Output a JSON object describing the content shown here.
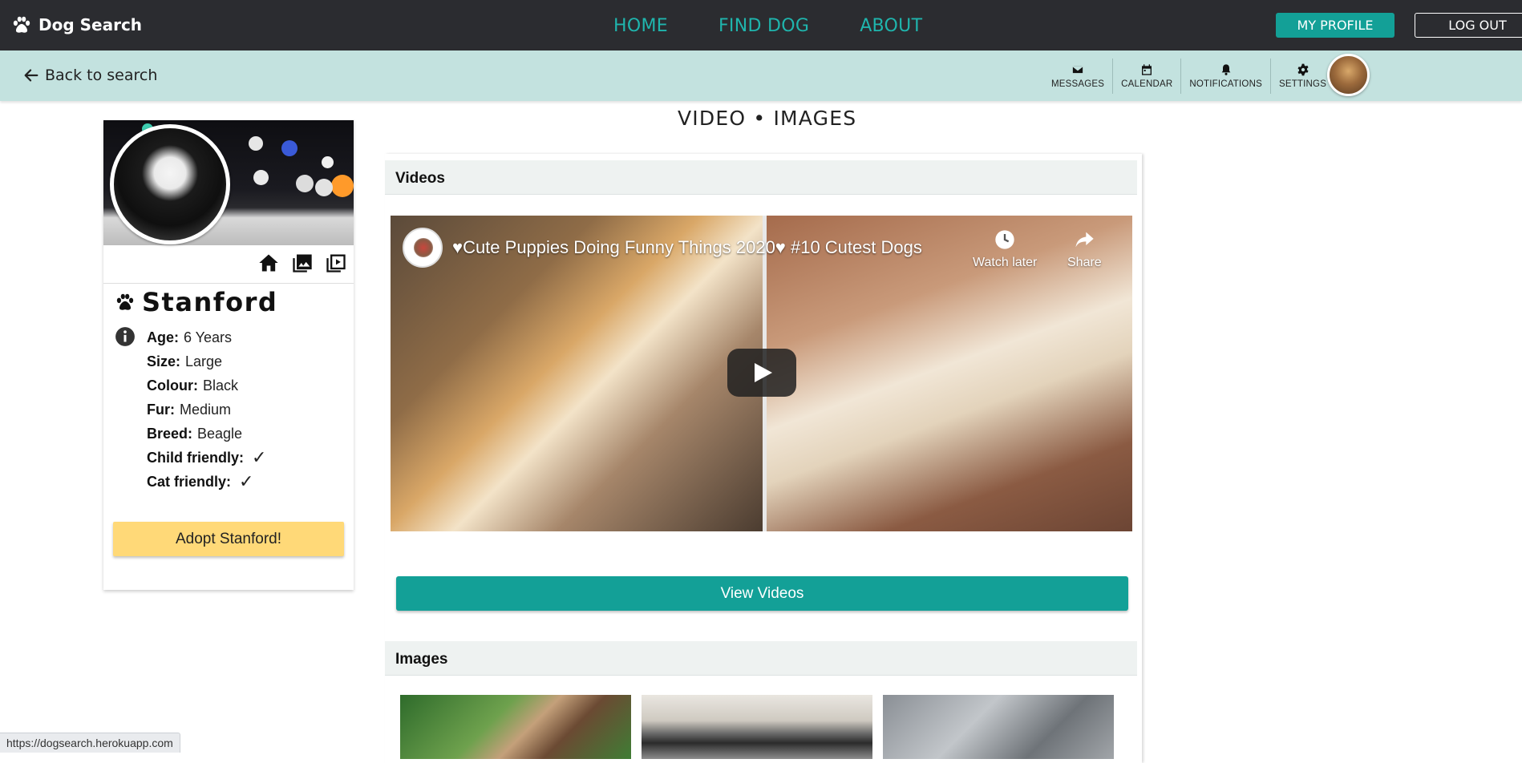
{
  "header": {
    "brand": "Dog Search",
    "nav": [
      "HOME",
      "FIND DOG",
      "ABOUT"
    ],
    "my_profile": "MY PROFILE",
    "logout": "LOG OUT"
  },
  "subbar": {
    "back": "Back to search",
    "tools": [
      {
        "label": "MESSAGES",
        "icon": "envelope-icon"
      },
      {
        "label": "CALENDAR",
        "icon": "calendar-icon"
      },
      {
        "label": "NOTIFICATIONS",
        "icon": "bell-icon"
      },
      {
        "label": "SETTINGS",
        "icon": "gear-icon"
      }
    ]
  },
  "dog": {
    "name": "Stanford",
    "details": [
      {
        "key": "Age:",
        "value": "6 Years"
      },
      {
        "key": "Size:",
        "value": "Large"
      },
      {
        "key": "Colour:",
        "value": "Black"
      },
      {
        "key": "Fur:",
        "value": "Medium"
      },
      {
        "key": "Breed:",
        "value": "Beagle"
      },
      {
        "key": "Child friendly:",
        "value": "✓"
      },
      {
        "key": "Cat friendly:",
        "value": "✓"
      }
    ],
    "adopt_label": "Adopt Stanford!"
  },
  "main": {
    "title": "VIDEO • IMAGES",
    "videos_heading": "Videos",
    "video_title": "♥Cute Puppies Doing Funny Things 2020♥ #10 Cutest Dogs",
    "watch_later": "Watch later",
    "share": "Share",
    "view_videos": "View Videos",
    "images_heading": "Images"
  },
  "status_bar": {
    "url": "https://dogsearch.herokuapp.com"
  },
  "colors": {
    "topbar": "#2b2c30",
    "accent": "#13a097",
    "nav_link": "#1fb5ad",
    "subbar": "#c3e2df",
    "adopt": "#ffd978"
  }
}
